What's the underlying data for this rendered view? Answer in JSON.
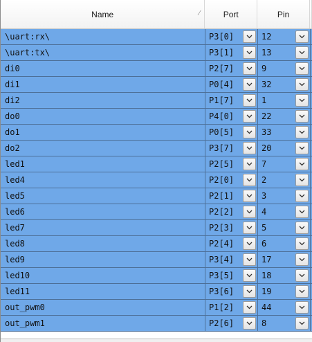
{
  "header": {
    "name": "Name",
    "port": "Port",
    "pin": "Pin"
  },
  "rows": [
    {
      "name": "\\uart:rx\\",
      "port": "P3[0]",
      "pin": "12"
    },
    {
      "name": "\\uart:tx\\",
      "port": "P3[1]",
      "pin": "13"
    },
    {
      "name": "di0",
      "port": "P2[7]",
      "pin": "9"
    },
    {
      "name": "di1",
      "port": "P0[4]",
      "pin": "32"
    },
    {
      "name": "di2",
      "port": "P1[7]",
      "pin": "1"
    },
    {
      "name": "do0",
      "port": "P4[0]",
      "pin": "22"
    },
    {
      "name": "do1",
      "port": "P0[5]",
      "pin": "33"
    },
    {
      "name": "do2",
      "port": "P3[7]",
      "pin": "20"
    },
    {
      "name": "led1",
      "port": "P2[5]",
      "pin": "7"
    },
    {
      "name": "led4",
      "port": "P2[0]",
      "pin": "2"
    },
    {
      "name": "led5",
      "port": "P2[1]",
      "pin": "3"
    },
    {
      "name": "led6",
      "port": "P2[2]",
      "pin": "4"
    },
    {
      "name": "led7",
      "port": "P2[3]",
      "pin": "5"
    },
    {
      "name": "led8",
      "port": "P2[4]",
      "pin": "6"
    },
    {
      "name": "led9",
      "port": "P3[4]",
      "pin": "17"
    },
    {
      "name": "led10",
      "port": "P3[5]",
      "pin": "18"
    },
    {
      "name": "led11",
      "port": "P3[6]",
      "pin": "19"
    },
    {
      "name": "out_pwm0",
      "port": "P1[2]",
      "pin": "44"
    },
    {
      "name": "out_pwm1",
      "port": "P2[6]",
      "pin": "8"
    }
  ],
  "colors": {
    "row_bg": "#6fa8e8",
    "grid_line": "#4d6f97"
  },
  "icons": {
    "sort": "sort-indicator-icon",
    "dropdown": "chevron-down-icon"
  }
}
